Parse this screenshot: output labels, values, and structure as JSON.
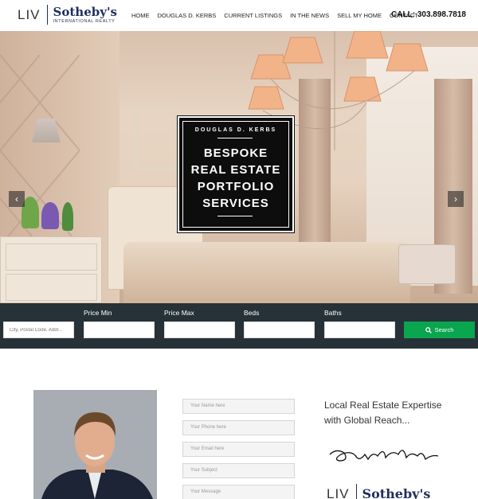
{
  "header": {
    "logo": {
      "liv": "LIV",
      "brand": "Sotheby's",
      "sub": "INTERNATIONAL REALTY"
    },
    "nav": [
      "HOME",
      "DOUGLAS D. KERBS",
      "CURRENT LISTINGS",
      "IN THE NEWS",
      "SELL MY HOME",
      "CONTACT"
    ],
    "phone": "CALL: 303.898.7818"
  },
  "hero": {
    "eyebrow": "DOUGLAS D. KERBS",
    "title_lines": [
      "BESPOKE",
      "REAL ESTATE",
      "PORTFOLIO",
      "SERVICES"
    ],
    "prev_arrow": "‹",
    "next_arrow": "›"
  },
  "search": {
    "location_placeholder": "City, Postal Code, Addr...",
    "price_min_label": "Price Min",
    "price_max_label": "Price Max",
    "beds_label": "Beds",
    "baths_label": "Baths",
    "button_label": "Search",
    "button_color": "#0aa54f"
  },
  "contact_form": {
    "name_placeholder": "Your Name here",
    "phone_placeholder": "Your Phone here",
    "email_placeholder": "Your Email here",
    "subject_placeholder": "Your Subject",
    "message_placeholder": "Your Message"
  },
  "about": {
    "tagline": "Local Real Estate Expertise with Global Reach..."
  },
  "colors": {
    "brand_navy": "#1f2f5c",
    "search_bar": "#263238",
    "accent_green": "#0aa54f"
  }
}
